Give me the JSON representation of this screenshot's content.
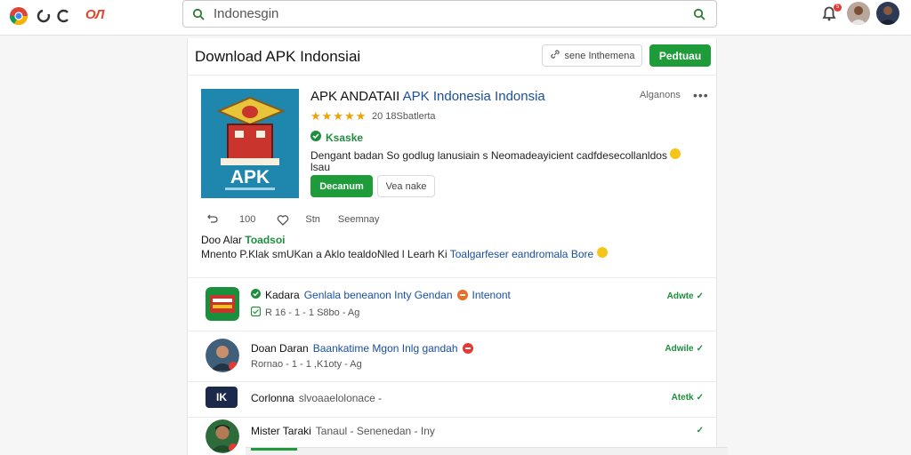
{
  "topbar": {
    "logo_text": "OЛ",
    "search": {
      "value": "Indonesgin",
      "placeholder": "Indonesgin"
    },
    "notification_badge": "5"
  },
  "header": {
    "title": "Download APK Indonsiai",
    "save_label": "sene Inthemena",
    "primary_label": "Pedtuau"
  },
  "app": {
    "name_prefix": "APK ANDATAII",
    "name_suffix": "APK Indonesia Indonsia",
    "meta_right": "Alganons",
    "rating_stars": "★★★★★",
    "rating_count": "20 18Sbatlerta",
    "verified_label": "Ksaske",
    "description_line1": "Dengant badan So godlug lanusiain s Neomadeayicient cadfdesecollanldos",
    "description_line2": "lsau",
    "install_label": "Decanum",
    "secondary_label": "Vea nake",
    "icon_text": "APK",
    "actions": {
      "count": "100",
      "like": "Stn",
      "share": "Seemnay"
    },
    "section_title_black": "Doo Alar",
    "section_title_green": "Toadsoi",
    "section_text_black": "Mnento P.Klak smUKan a Aklo tealdoNled l Learh Ki",
    "section_text_blue": "Toalgarfeser eandromala Bore"
  },
  "list": [
    {
      "title_black": "Kadara",
      "title_blue": "Genlala beneanon Inty Gendan",
      "title_tail": "Intenont",
      "sub": "R 16 - 1 - 1 S8bo - Ag",
      "status": "Adwte"
    },
    {
      "title_black": "Doan Daran",
      "title_blue": "Baankatime Mgon Inlg gandah",
      "title_tail": "",
      "sub": "Rornao - 1 - 1 ,K1oty - Ag",
      "status": "Adwile"
    },
    {
      "title_black": "Corlonna",
      "title_blue": "",
      "title_tail": "",
      "sub_inline": "slvoaaelolonace -",
      "thumb_text": "IK",
      "status": "Atetk"
    },
    {
      "title_black": "Mister Taraki",
      "title_blue": "",
      "title_tail": "",
      "sub_inline": "Tanaul - Senenedan - Iny",
      "status": ""
    }
  ],
  "colors": {
    "accent_green": "#1e9c3a",
    "link_blue": "#1a4fa0",
    "star": "#f2a100",
    "badge_red": "#e53935"
  },
  "icons": {
    "browser": "chrome-logo-icon",
    "back": "back-icon",
    "refresh": "refresh-icon",
    "search": "search-icon",
    "notifications": "bell-icon",
    "more": "more-horizontal-icon",
    "verified": "check-circle-icon",
    "like": "heart-icon",
    "share": "share-icon"
  }
}
